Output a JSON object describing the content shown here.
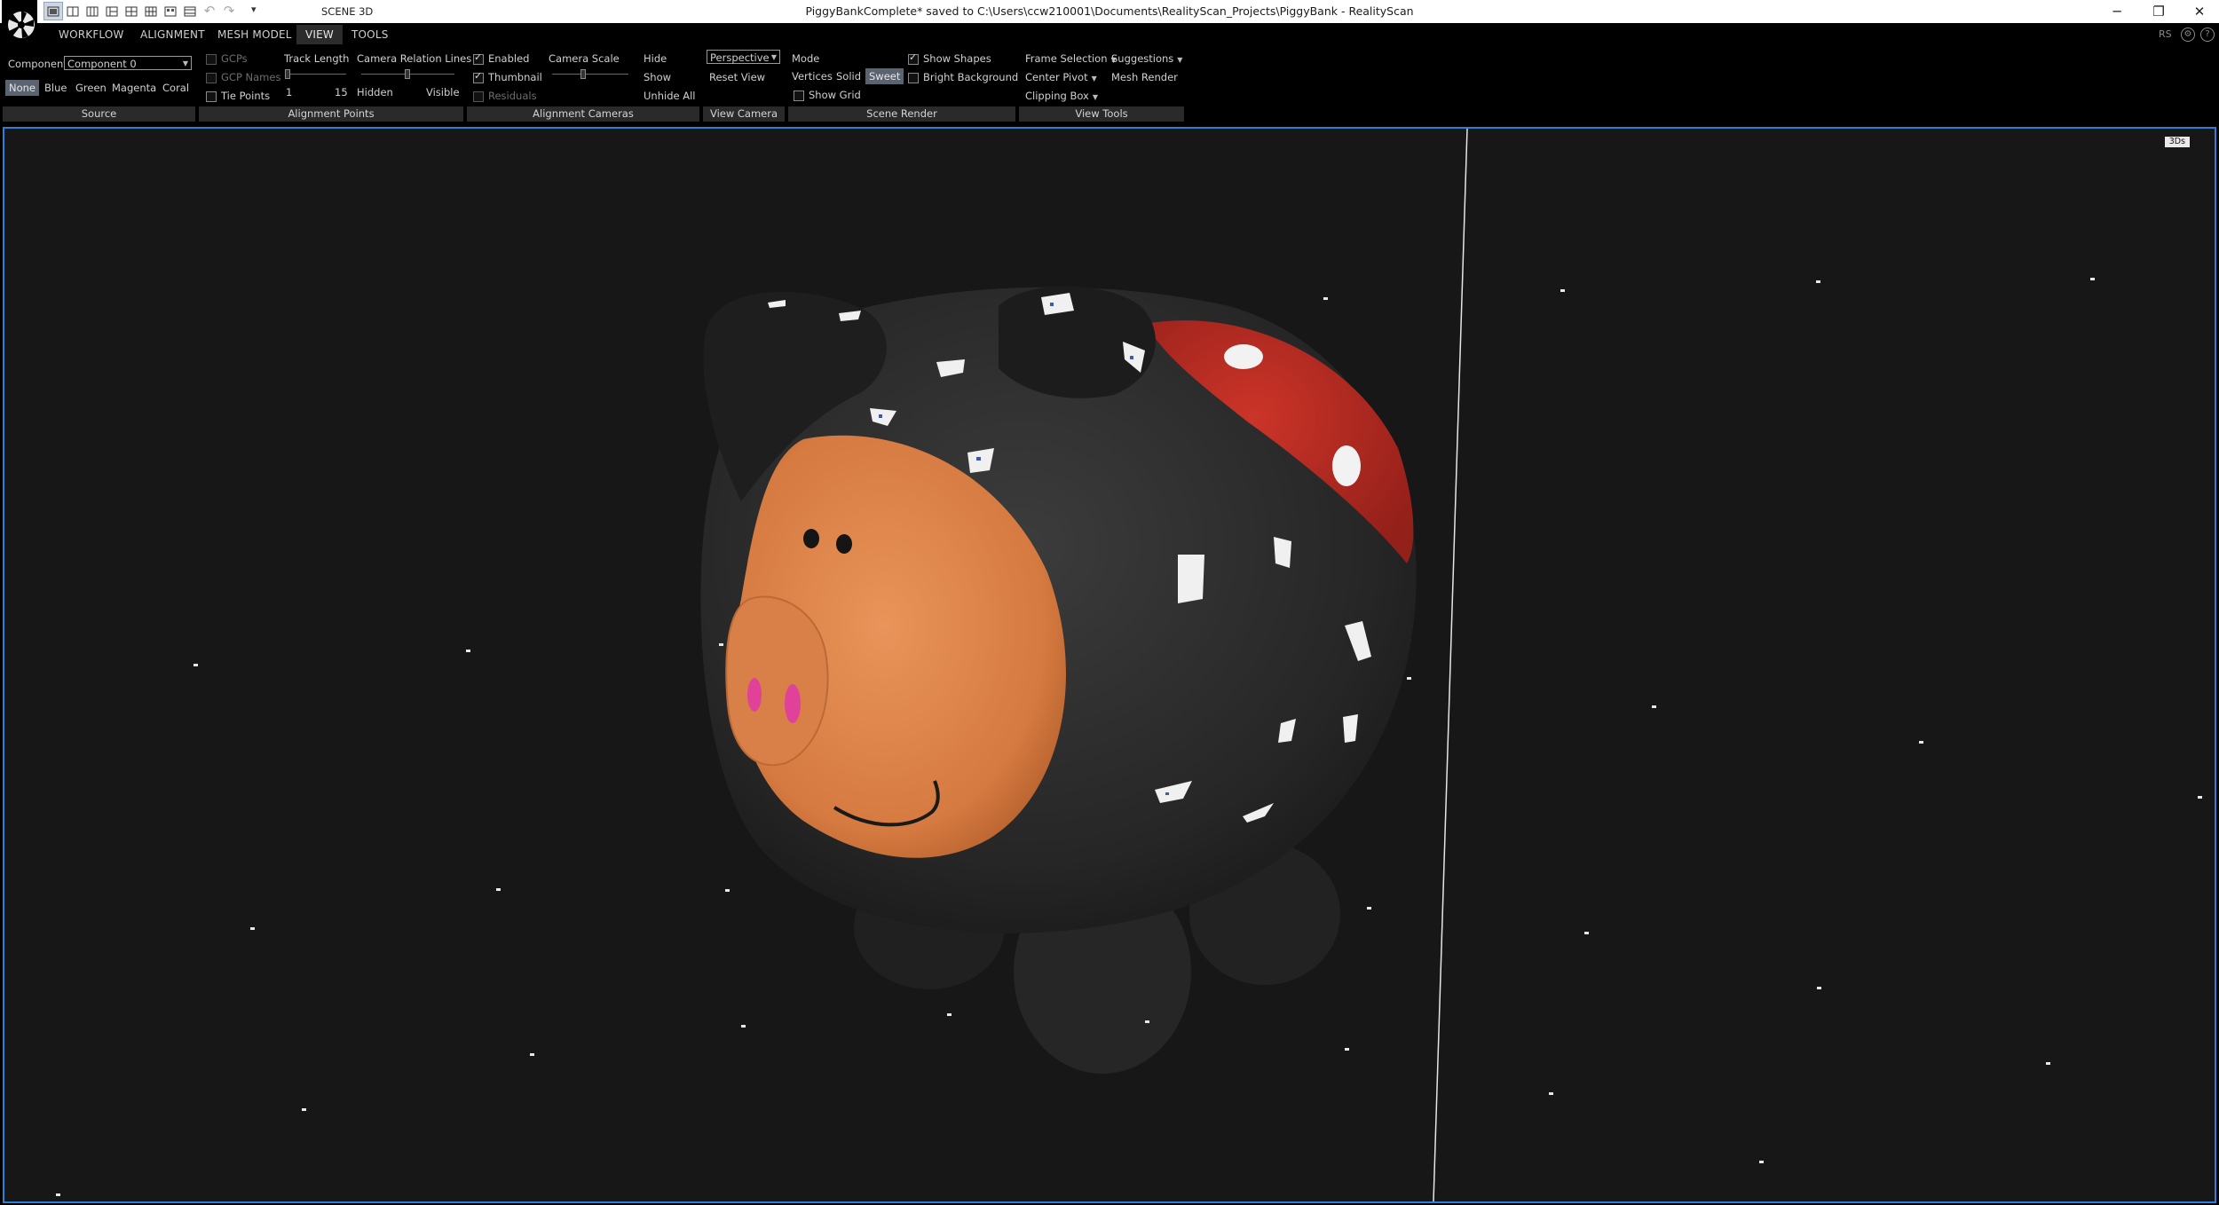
{
  "titlebar": {
    "scene_title": "SCENE 3D",
    "document_title": "PiggyBankComplete* saved to C:\\Users\\ccw210001\\Documents\\RealityScan_Projects\\PiggyBank - RealityScan",
    "qa_dropdown": "▾",
    "minimize": "─",
    "restore": "❐",
    "close": "✕"
  },
  "menu": {
    "tabs": [
      "WORKFLOW",
      "ALIGNMENT",
      "MESH MODEL",
      "VIEW",
      "TOOLS"
    ],
    "active_tab": "VIEW",
    "right_label": "RS",
    "help": "?"
  },
  "ribbon": {
    "source": {
      "group_label": "Source",
      "component_label": "Component",
      "component_value": "Component 0",
      "colors": [
        "None",
        "Blue",
        "Green",
        "Magenta",
        "Coral"
      ],
      "selected_color": "None"
    },
    "alignment_points": {
      "group_label": "Alignment Points",
      "gcps": "GCPs",
      "gcp_names": "GCP Names",
      "tie_points": "Tie Points",
      "track_length_label": "Track Length",
      "track_min": "1",
      "track_max": "15",
      "camera_relation_lines": "Camera Relation Lines",
      "hidden": "Hidden",
      "visible": "Visible"
    },
    "alignment_cameras": {
      "group_label": "Alignment Cameras",
      "enabled": "Enabled",
      "thumbnail": "Thumbnail",
      "residuals": "Residuals",
      "camera_scale": "Camera Scale",
      "hide": "Hide",
      "show": "Show",
      "unhide_all": "Unhide All"
    },
    "view_camera": {
      "group_label": "View Camera",
      "projection": "Perspective",
      "reset_view": "Reset View"
    },
    "scene_render": {
      "group_label": "Scene Render",
      "mode_label": "Mode",
      "modes": [
        "Vertices",
        "Solid",
        "Sweet"
      ],
      "selected_mode": "Sweet",
      "show_grid": "Show Grid",
      "show_shapes": "Show Shapes",
      "bright_background": "Bright Background"
    },
    "view_tools": {
      "group_label": "View Tools",
      "frame_selection": "Frame Selection",
      "suggestions": "Suggestions",
      "center_pivot": "Center Pivot",
      "mesh_render": "Mesh Render",
      "clipping_box": "Clipping Box"
    }
  },
  "viewport": {
    "badge": "3Ds",
    "model": "piggy bank 3D mesh",
    "colors": {
      "border": "#2e7fd6",
      "background": "#171717",
      "body": "#2b2b2b",
      "snout": "#d97d43",
      "nostrils": "#e0429a",
      "red_patch": "#b82a22"
    }
  }
}
